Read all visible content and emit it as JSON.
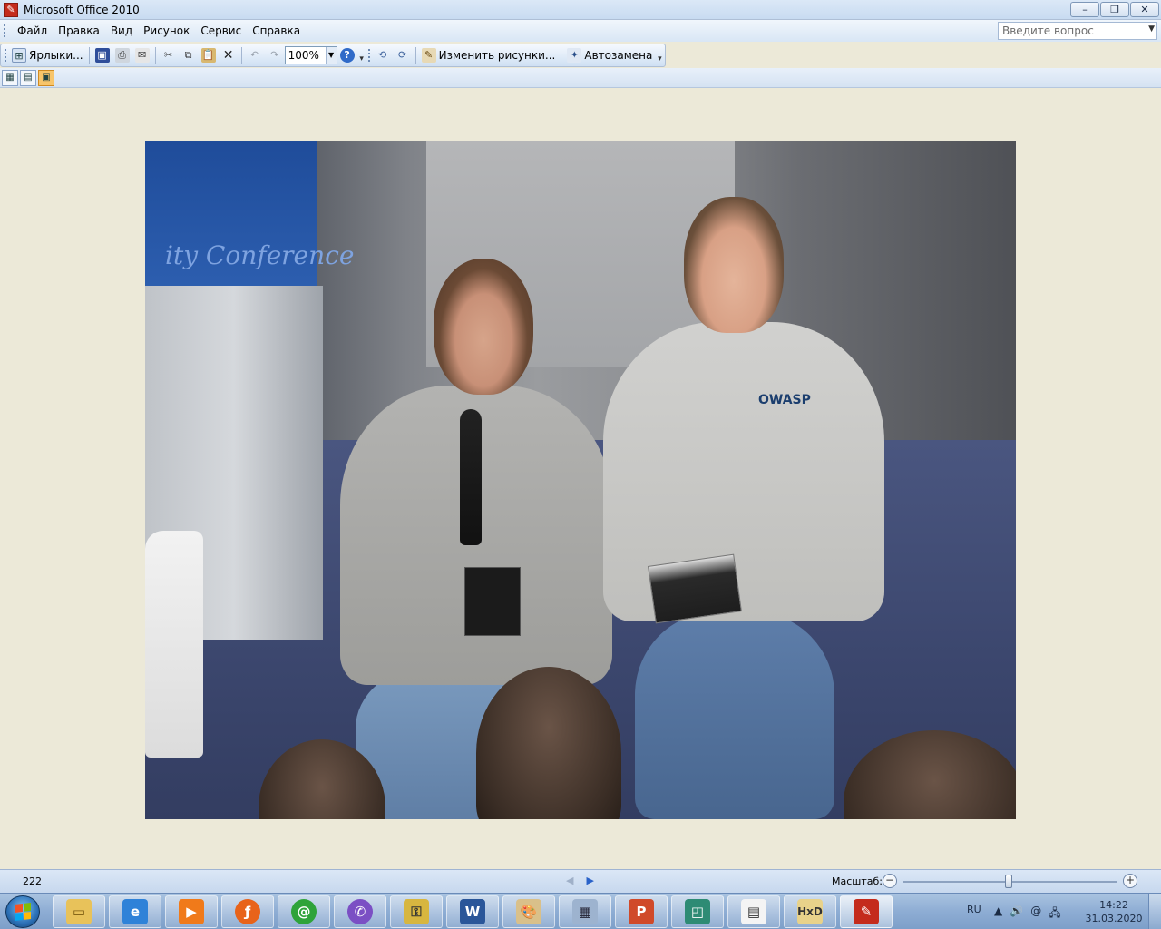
{
  "window": {
    "title": "Microsoft Office 2010",
    "controls": [
      "–",
      "❐",
      "✕"
    ]
  },
  "menu": {
    "items": [
      "Файл",
      "Правка",
      "Вид",
      "Рисунок",
      "Сервис",
      "Справка"
    ],
    "help_placeholder": "Введите вопрос"
  },
  "toolbar": {
    "shortcuts_label": "Ярлыки...",
    "zoom_value": "100%",
    "edit_pictures_label": "Изменить рисунки...",
    "autocorrect_label": "Автозамена"
  },
  "photo": {
    "stage_banner_text": "ity Conference",
    "shirt_logo": "OWASP"
  },
  "status": {
    "page_info": "222",
    "zoom_label": "Масштаб:"
  },
  "zoom_level_fraction": 0.49,
  "taskbar": {
    "language": "RU",
    "time": "14:22",
    "date": "31.03.2020"
  },
  "colors": {
    "accent": "#2b6fb5",
    "active_view": "#f8c56a"
  }
}
